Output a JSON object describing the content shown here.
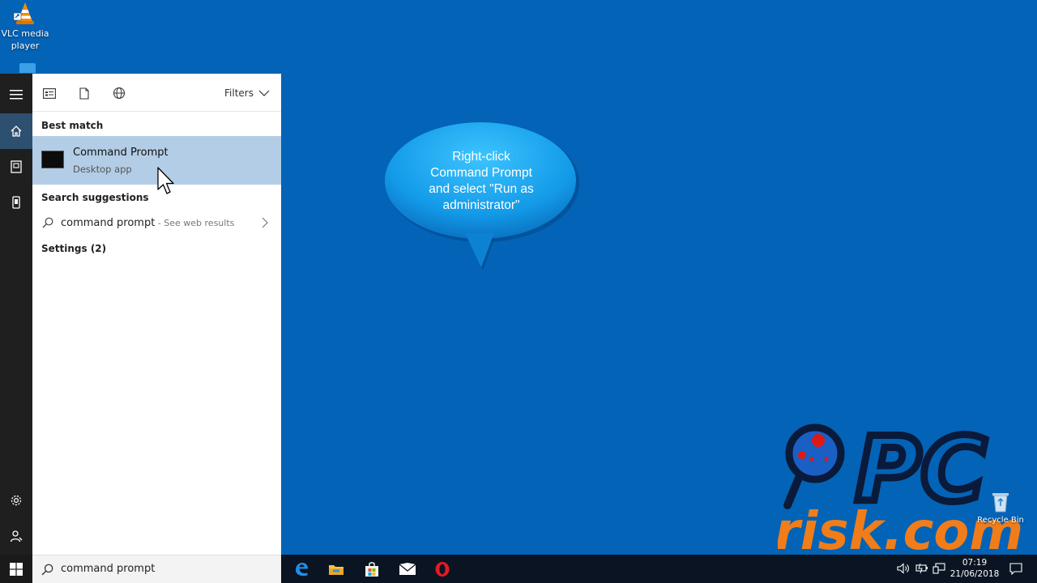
{
  "desktop": {
    "icons": [
      {
        "label_line1": "VLC media",
        "label_line2": "player",
        "icon": "vlc-cone-icon"
      },
      {
        "label": "Recycle Bin",
        "icon": "recycle-bin-icon"
      }
    ]
  },
  "callout": {
    "line1": "Right-click",
    "line2": "Command  Prompt",
    "line3": "and select \"Run as",
    "line4": "administrator\""
  },
  "watermark": {
    "line1": "PC",
    "line2": "risk.com"
  },
  "start_menu": {
    "rail": [
      "hamburger-icon",
      "home-icon",
      "documents-icon",
      "device-icon",
      "settings-icon",
      "user-icon"
    ],
    "header": {
      "filters_label": "Filters",
      "icons": [
        "apps-filter-icon",
        "documents-filter-icon",
        "web-filter-icon"
      ]
    },
    "best_match_heading": "Best match",
    "best_match": {
      "name": "Command Prompt",
      "subtitle": "Desktop app"
    },
    "search_suggestions_heading": "Search suggestions",
    "suggestion": {
      "query": "command prompt",
      "hint": " - See web results"
    },
    "settings_heading": "Settings (2)"
  },
  "taskbar": {
    "search_value": "command prompt",
    "apps": [
      "edge-icon",
      "file-explorer-icon",
      "store-icon",
      "mail-icon",
      "opera-icon"
    ],
    "clock_time": "07:19",
    "clock_date": "21/06/2018"
  },
  "colors": {
    "desktop": "#0363b7",
    "selection": "#b3cde6",
    "bubble": "#1aa3ef",
    "watermark_orange": "#f07d1a"
  }
}
